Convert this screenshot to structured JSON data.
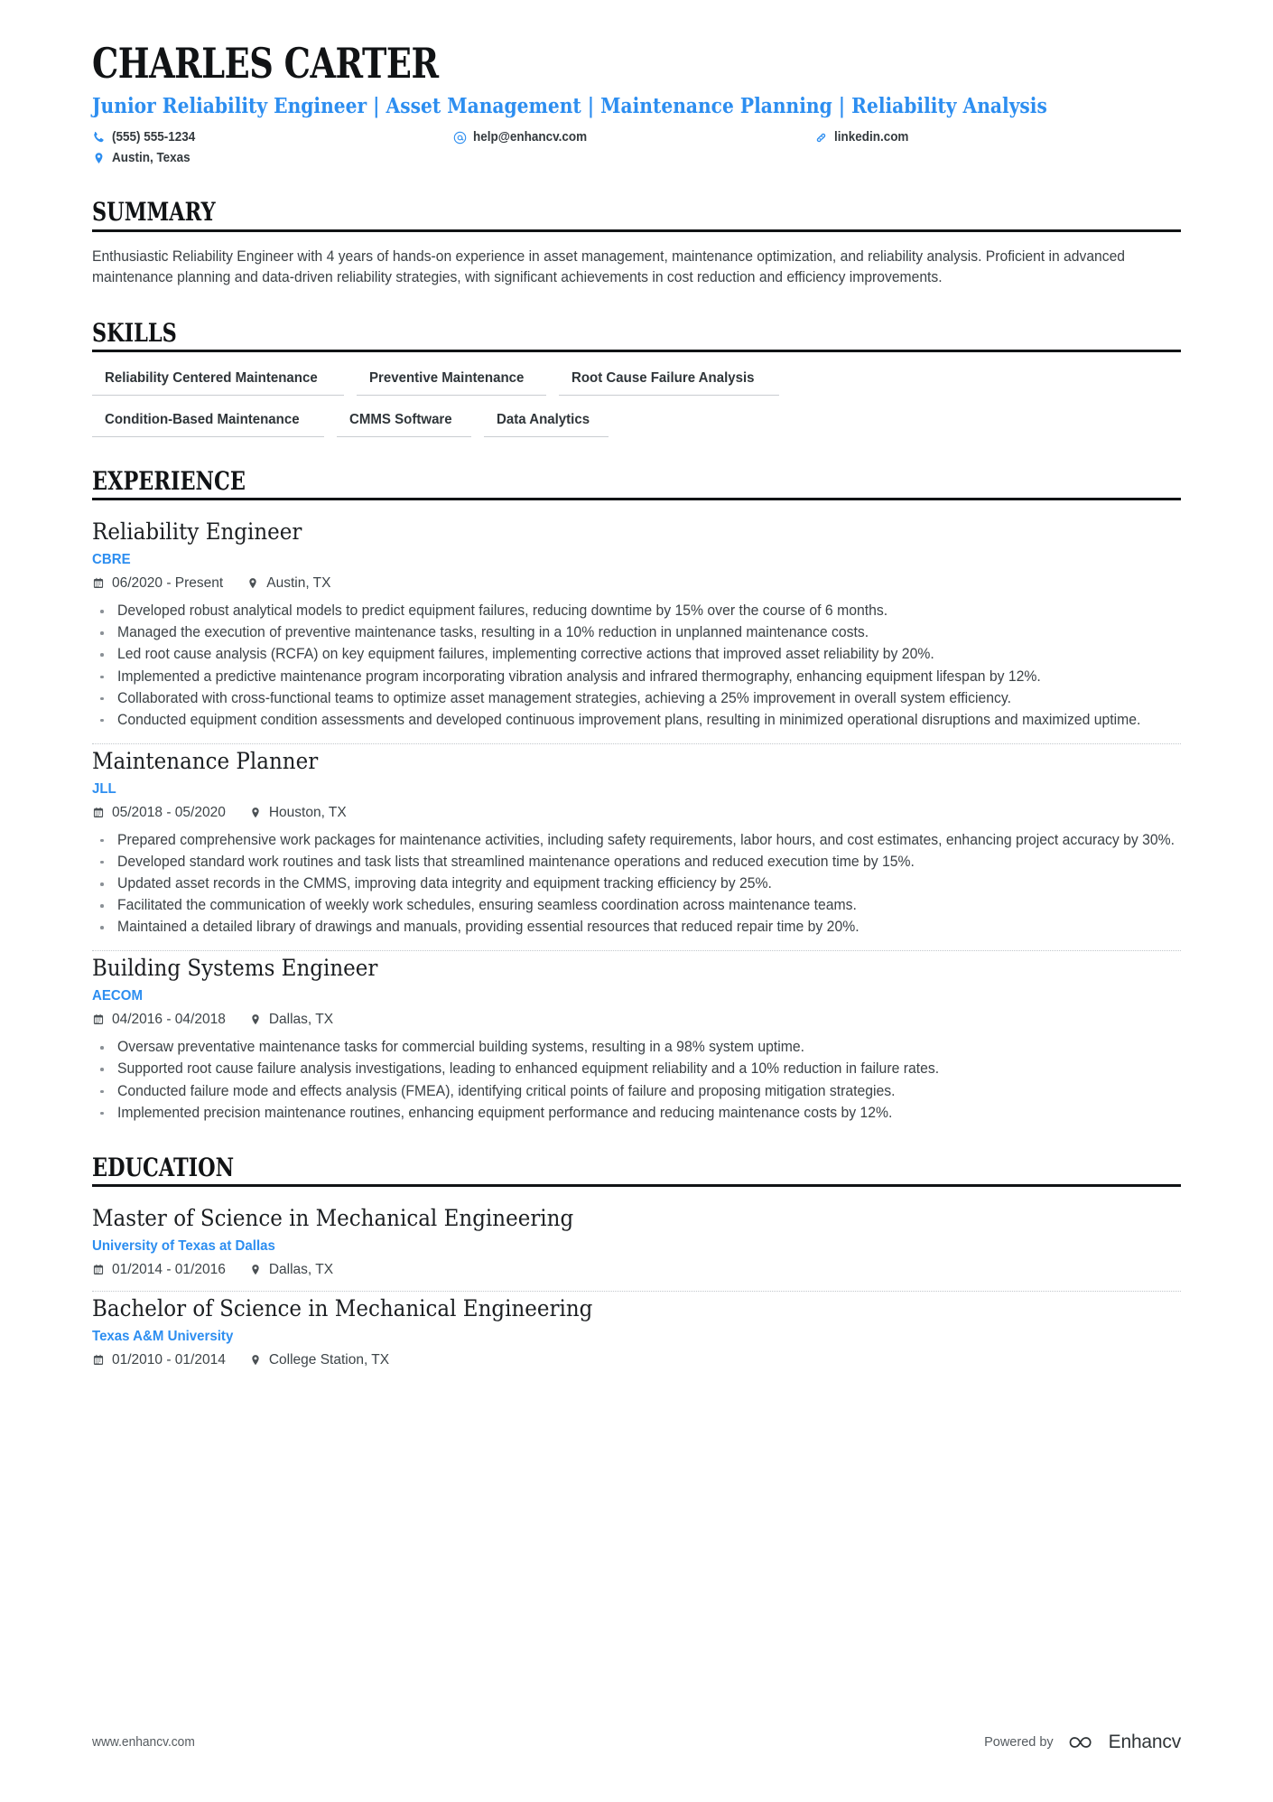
{
  "header": {
    "name": "CHARLES CARTER",
    "headline": "Junior Reliability Engineer | Asset Management | Maintenance Planning | Reliability Analysis",
    "contacts": [
      {
        "icon": "phone-icon",
        "value": "(555) 555-1234"
      },
      {
        "icon": "email-icon",
        "value": "help@enhancv.com"
      },
      {
        "icon": "link-icon",
        "value": "linkedin.com"
      },
      {
        "icon": "location-icon",
        "value": "Austin, Texas"
      }
    ]
  },
  "colors": {
    "accent": "#2d8ef0",
    "heading": "#111315",
    "body": "#3c4246",
    "rule": "#111315",
    "chip_underline": "#c9cdd1",
    "divider": "#c2c7cc"
  },
  "sections": {
    "summary": {
      "title": "SUMMARY",
      "text": "Enthusiastic Reliability Engineer with 4 years of hands-on experience in asset management, maintenance optimization, and reliability analysis. Proficient in advanced maintenance planning and data-driven reliability strategies, with significant achievements in cost reduction and efficiency improvements."
    },
    "skills": {
      "title": "SKILLS",
      "rows": [
        [
          "Reliability Centered Maintenance",
          "Preventive Maintenance",
          "Root Cause Failure Analysis"
        ],
        [
          "Condition-Based Maintenance",
          "CMMS Software",
          "Data Analytics"
        ]
      ]
    },
    "experience": {
      "title": "EXPERIENCE",
      "entries": [
        {
          "title": "Reliability Engineer",
          "org": "CBRE",
          "dates": "06/2020 - Present",
          "location": "Austin, TX",
          "bullets": [
            "Developed robust analytical models to predict equipment failures, reducing downtime by 15% over the course of 6 months.",
            "Managed the execution of preventive maintenance tasks, resulting in a 10% reduction in unplanned maintenance costs.",
            "Led root cause analysis (RCFA) on key equipment failures, implementing corrective actions that improved asset reliability by 20%.",
            "Implemented a predictive maintenance program incorporating vibration analysis and infrared thermography, enhancing equipment lifespan by 12%.",
            "Collaborated with cross-functional teams to optimize asset management strategies, achieving a 25% improvement in overall system efficiency.",
            "Conducted equipment condition assessments and developed continuous improvement plans, resulting in minimized operational disruptions and maximized uptime."
          ]
        },
        {
          "title": "Maintenance Planner",
          "org": "JLL",
          "dates": "05/2018 - 05/2020",
          "location": "Houston, TX",
          "bullets": [
            "Prepared comprehensive work packages for maintenance activities, including safety requirements, labor hours, and cost estimates, enhancing project accuracy by 30%.",
            "Developed standard work routines and task lists that streamlined maintenance operations and reduced execution time by 15%.",
            "Updated asset records in the CMMS, improving data integrity and equipment tracking efficiency by 25%.",
            "Facilitated the communication of weekly work schedules, ensuring seamless coordination across maintenance teams.",
            "Maintained a detailed library of drawings and manuals, providing essential resources that reduced repair time by 20%."
          ]
        },
        {
          "title": "Building Systems Engineer",
          "org": "AECOM",
          "dates": "04/2016 - 04/2018",
          "location": "Dallas, TX",
          "bullets": [
            "Oversaw preventative maintenance tasks for commercial building systems, resulting in a 98% system uptime.",
            "Supported root cause failure analysis investigations, leading to enhanced equipment reliability and a 10% reduction in failure rates.",
            "Conducted failure mode and effects analysis (FMEA), identifying critical points of failure and proposing mitigation strategies.",
            "Implemented precision maintenance routines, enhancing equipment performance and reducing maintenance costs by 12%."
          ]
        }
      ]
    },
    "education": {
      "title": "EDUCATION",
      "entries": [
        {
          "title": "Master of Science in Mechanical Engineering",
          "org": "University of Texas at Dallas",
          "dates": "01/2014 - 01/2016",
          "location": "Dallas, TX"
        },
        {
          "title": "Bachelor of Science in Mechanical Engineering",
          "org": "Texas A&M University",
          "dates": "01/2010 - 01/2014",
          "location": "College Station, TX"
        }
      ]
    }
  },
  "footer": {
    "url": "www.enhancv.com",
    "powered_by": "Powered by",
    "brand": "Enhancv"
  }
}
